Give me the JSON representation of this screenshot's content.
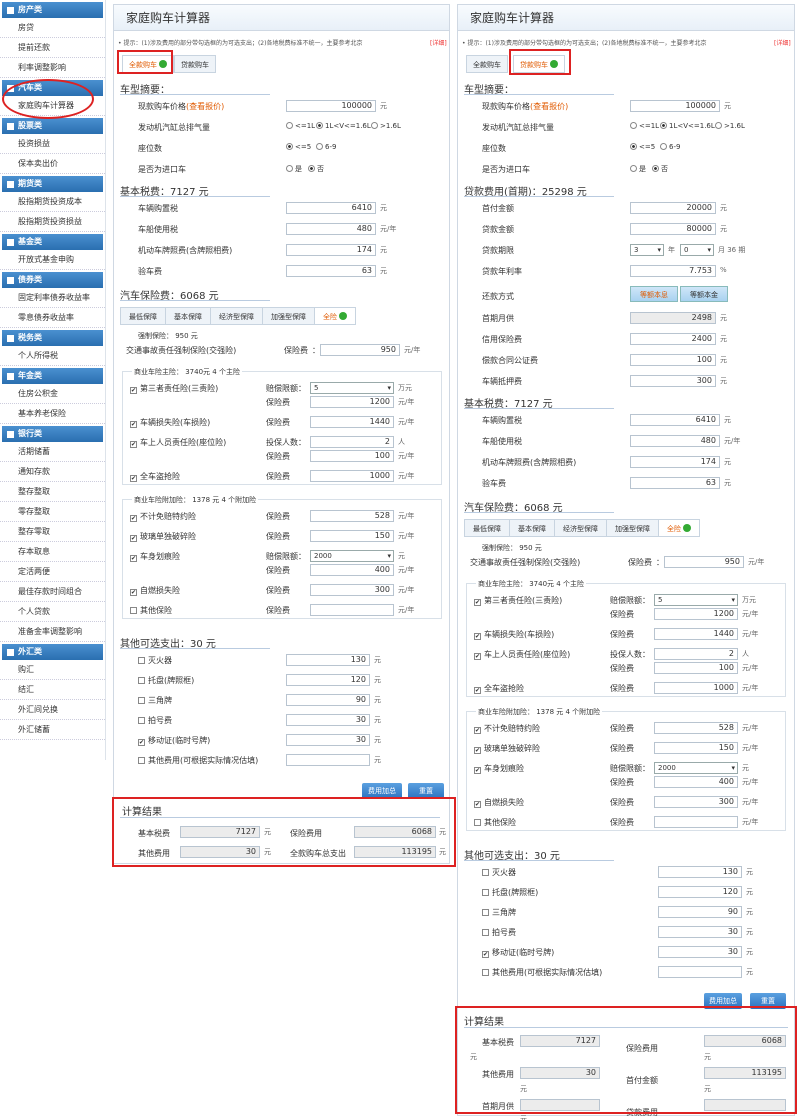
{
  "sidebar": {
    "groups": [
      {
        "title": "房产类",
        "items": [
          "房贷",
          "提前还款",
          "利率调整影响"
        ]
      },
      {
        "title": "汽车类",
        "items": [
          "家庭购车计算器"
        ]
      },
      {
        "title": "股票类",
        "items": [
          "投资损益",
          "保本卖出价"
        ]
      },
      {
        "title": "期货类",
        "items": [
          "股指期货投资成本",
          "股指期货投资损益"
        ]
      },
      {
        "title": "基金类",
        "items": [
          "开放式基金申购"
        ]
      },
      {
        "title": "债券类",
        "items": [
          "固定利率债券收益率",
          "零息债券收益率"
        ]
      },
      {
        "title": "税务类",
        "items": [
          "个人所得税"
        ]
      },
      {
        "title": "年金类",
        "items": [
          "住房公积金",
          "基本养老保险"
        ]
      },
      {
        "title": "银行类",
        "items": [
          "活期储蓄",
          "通知存款",
          "整存整取",
          "零存整取",
          "整存零取",
          "存本取息",
          "定活两便",
          "最佳存款时间组合",
          "个人贷款",
          "准备金率调整影响"
        ]
      },
      {
        "title": "外汇类",
        "items": [
          "购汇",
          "结汇",
          "外汇间兑换",
          "外汇储蓄"
        ]
      }
    ]
  },
  "common": {
    "title": "家庭购车计算器",
    "tip": "• 提示：(1)涉及费用的部分带勾选框的为可选支出；(2)各地税费标准不统一，主要参考北京",
    "detail": "[详细]",
    "tab_full": "全款购车",
    "tab_loan": "贷款购车",
    "summary_title": "车型摘要：",
    "price_label": "现款购车价格",
    "price_link": "(查看报价)",
    "price_value": "100000",
    "unit_yuan": "元",
    "unit_yuan_year": "元/年",
    "unit_wanyuan": "万元",
    "unit_ren": "人",
    "engine_label": "发动机汽缸总排气量",
    "engine_opts": [
      "<=1L",
      "1L<V<=1.6L",
      ">1.6L"
    ],
    "seats_label": "座位数",
    "seats_opts": [
      "<=5",
      "6-9"
    ],
    "import_label": "是否为进口车",
    "import_opts": [
      "是",
      "否"
    ],
    "tax_title": "基本税费：",
    "tax_total": "7127 元",
    "tax_items": [
      {
        "label": "车辆购置税",
        "value": "6410",
        "unit": "元"
      },
      {
        "label": "车船使用税",
        "value": "480",
        "unit": "元/年"
      },
      {
        "label": "机动车牌照费(含牌照相费)",
        "value": "174",
        "unit": "元"
      },
      {
        "label": "验车费",
        "value": "63",
        "unit": "元"
      }
    ],
    "ins_title": "汽车保险费：",
    "ins_total": "6068 元",
    "ins_tabs": [
      "最低保障",
      "基本保障",
      "经济型保障",
      "加强型保障",
      "全险"
    ],
    "mandatory": "强制保险： 950 元",
    "jqx_label": "交通事故责任强制保险(交强险)",
    "fee_label": "保险费",
    "colon": "：",
    "jqx_value": "950",
    "main_group": "商业车险主险： 3740元 4 个主险",
    "third": "第三者责任险(三责险)",
    "limit_label": "赔偿限额：",
    "third_limit": "5",
    "third_fee": "1200",
    "damage": "车辆损失险(车损险)",
    "damage_fee": "1440",
    "seat_ins": "车上人员责任险(座位险)",
    "insured_label": "投保人数：",
    "seat_count": "2",
    "seat_fee": "100",
    "theft": "全车盗抢险",
    "theft_fee": "1000",
    "add_group": "商业车险附加险： 1378 元 4 个附加险",
    "nodeduct": "不计免赔特约险",
    "nodeduct_fee": "528",
    "glass": "玻璃单独破碎险",
    "glass_fee": "150",
    "scratch": "车身划痕险",
    "scratch_limit": "2000",
    "scratch_fee": "400",
    "fire": "自燃损失险",
    "fire_fee": "300",
    "other_ins": "其他保险",
    "opt_title": "其他可选支出：",
    "opt_total": "30 元",
    "opt_items": [
      {
        "label": "灭火器",
        "value": "130",
        "checked": false
      },
      {
        "label": "托盘(牌照框)",
        "value": "120",
        "checked": false
      },
      {
        "label": "三角牌",
        "value": "90",
        "checked": false
      },
      {
        "label": "拍号费",
        "value": "30",
        "checked": false
      },
      {
        "label": "移动证(临时号牌)",
        "value": "30",
        "checked": true
      },
      {
        "label": "其他费用(可根据实际情况估填)",
        "value": "",
        "checked": false
      }
    ],
    "btn_calc": "费用加总",
    "btn_reset": "重置",
    "result_title": "计算结果",
    "res_tax": "基本税费",
    "res_tax_val": "7127",
    "res_ins": "保险费用",
    "res_ins_val": "6068",
    "res_other": "其他费用",
    "res_other_val": "30",
    "res_total": "全款购车总支出",
    "res_total_val": "113195"
  },
  "loan": {
    "loan_title": "贷款费用(首期)：",
    "loan_total": "25298 元",
    "down_label": "首付金额",
    "down_value": "20000",
    "amount_label": "贷款金额",
    "amount_value": "80000",
    "term_label": "贷款期限",
    "term_year": "3",
    "term_year_unit": "年",
    "term_month": "0",
    "term_month_unit": "月 36 期",
    "rate_label": "贷款年利率",
    "rate_value": "7.753",
    "rate_unit": "%",
    "repay_label": "还款方式",
    "repay_opt1": "等额本息",
    "repay_opt2": "等额本金",
    "first_label": "首期月供",
    "first_value": "2498",
    "credit_label": "信用保险费",
    "credit_value": "2400",
    "notary_label": "偿款合同公证费",
    "notary_value": "100",
    "mortgage_label": "车辆抵押费",
    "mortgage_value": "300",
    "res_tax": "基本税费",
    "res_ins": "保险费用",
    "res_other": "其他费用",
    "res_down": "首付金额",
    "res_down_val": "113195",
    "res_first": "首期月供",
    "res_loan": "贷款费用"
  }
}
